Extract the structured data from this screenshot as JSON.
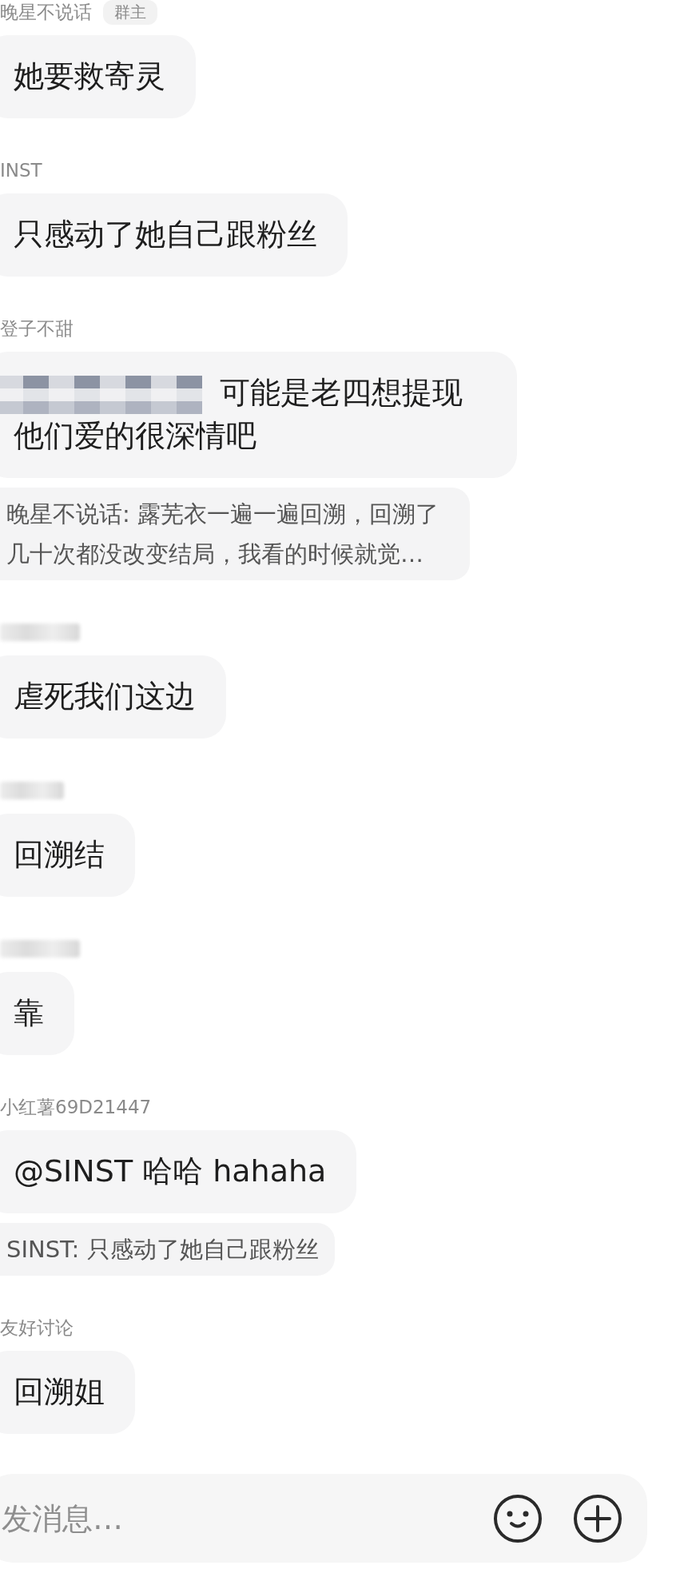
{
  "messages": [
    {
      "author": "晚星不说话",
      "badge": "群主",
      "text": "她要救寄灵"
    },
    {
      "author": "INST",
      "text": "只感动了她自己跟粉丝"
    },
    {
      "author": "登子不甜",
      "mention_redacted": true,
      "text": "可能是老四想提现他们爱的很深情吧",
      "quote": "晚星不说话: 露芜衣一遍一遍回溯，回溯了几十次都没改变结局，我看的时候就觉…"
    },
    {
      "author_redacted": true,
      "text": "虐死我们这边"
    },
    {
      "author_redacted": true,
      "text": "回溯结"
    },
    {
      "author_redacted": true,
      "text": "靠"
    },
    {
      "author": "小红薯69D21447",
      "text": "@SINST  哈哈 hahaha",
      "quote": "SINST: 只感动了她自己跟粉丝"
    },
    {
      "author": "友好讨论",
      "text": "回溯姐"
    }
  ],
  "composer": {
    "placeholder": "发消息…"
  }
}
